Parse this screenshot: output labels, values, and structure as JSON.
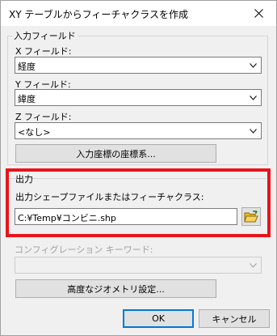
{
  "window": {
    "title": "XY テーブルからフィーチャクラスを作成"
  },
  "input_fields": {
    "group_label": "入力フィールド",
    "x_label": "X フィールド:",
    "x_value": "経度",
    "y_label": "Y フィールド:",
    "y_value": "緯度",
    "z_label": "Z フィールド:",
    "z_value": "<なし>",
    "coord_button": "入力座標の座標系..."
  },
  "output": {
    "group_label": "出力",
    "file_label": "出力シェープファイルまたはフィーチャクラス:",
    "file_value": "C:¥Temp¥コンビニ.shp"
  },
  "config": {
    "keyword_label": "コンフィグレーション キーワード:",
    "keyword_value": "",
    "advanced_button": "高度なジオメトリ設定..."
  },
  "footer": {
    "ok_label": "OK",
    "cancel_label": "キャンセル"
  },
  "colors": {
    "highlight_frame": "#e8141b",
    "default_button_border": "#0078d7"
  },
  "icons": {
    "close": "close-icon",
    "dropdown": "chevron-down-icon",
    "browse": "folder-open-icon"
  }
}
